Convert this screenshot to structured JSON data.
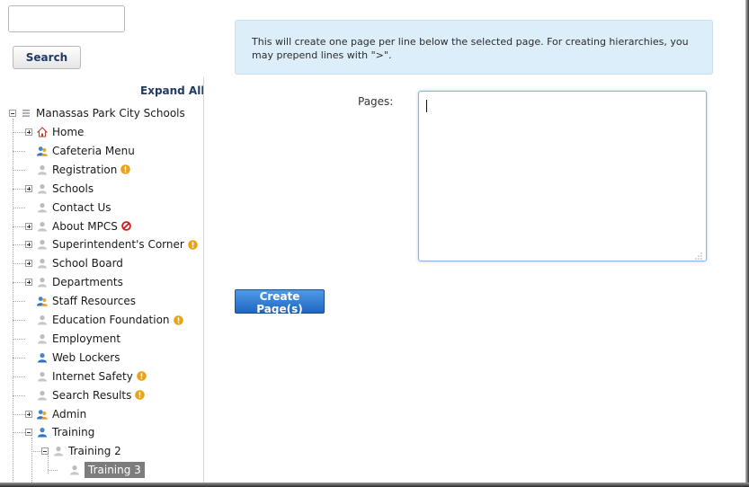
{
  "search": {
    "button_label": "Search",
    "input_value": ""
  },
  "tree": {
    "expand_all_label": "Expand All",
    "root": {
      "label": "Manassas Park City Schools"
    },
    "items": [
      {
        "label": "Home",
        "icon": "home-icon",
        "status": null,
        "expander": "plus"
      },
      {
        "label": "Cafeteria Menu",
        "icon": "user-group-icon",
        "status": null,
        "expander": null
      },
      {
        "label": "Registration",
        "icon": "user-gray-icon",
        "status": "warning",
        "expander": null
      },
      {
        "label": "Schools",
        "icon": "user-gray-icon",
        "status": null,
        "expander": "plus"
      },
      {
        "label": "Contact Us",
        "icon": "user-gray-icon",
        "status": null,
        "expander": null
      },
      {
        "label": "About MPCS",
        "icon": "user-gray-icon",
        "status": "blocked",
        "expander": "plus"
      },
      {
        "label": "Superintendent's Corner",
        "icon": "user-gray-icon",
        "status": "warning",
        "expander": "plus"
      },
      {
        "label": "School Board",
        "icon": "user-gray-icon",
        "status": null,
        "expander": "plus"
      },
      {
        "label": "Departments",
        "icon": "user-gray-icon",
        "status": null,
        "expander": "plus"
      },
      {
        "label": "Staff Resources",
        "icon": "user-group-icon",
        "status": null,
        "expander": null
      },
      {
        "label": "Education Foundation",
        "icon": "user-gray-icon",
        "status": "warning",
        "expander": null
      },
      {
        "label": "Employment",
        "icon": "user-gray-icon",
        "status": null,
        "expander": null
      },
      {
        "label": "Web Lockers",
        "icon": "user-blue-icon",
        "status": null,
        "expander": null
      },
      {
        "label": "Internet Safety",
        "icon": "user-gray-icon",
        "status": "warning",
        "expander": null
      },
      {
        "label": "Search Results",
        "icon": "user-gray-icon",
        "status": "warning",
        "expander": null
      },
      {
        "label": "Admin",
        "icon": "user-group-icon",
        "status": null,
        "expander": "plus"
      },
      {
        "label": "Training",
        "icon": "user-blue-icon",
        "status": null,
        "expander": "minus"
      },
      {
        "label": "Training 2",
        "icon": "user-gray-icon",
        "status": null,
        "expander": "minus"
      },
      {
        "label": "Training 3",
        "icon": "user-gray-icon",
        "status": null,
        "expander": null,
        "selected": true
      }
    ]
  },
  "info_text": "This will create one page per line below the selected page. For creating hierarchies, you may prepend lines with \">\".",
  "form": {
    "pages_label": "Pages:",
    "pages_value": "",
    "create_button_label": "Create Page(s)"
  },
  "colors": {
    "info_bg": "#ddeefb",
    "primary_button": "#2a74cf",
    "warning": "#e8a317",
    "blocked": "#cc1e1e",
    "selected_bg": "#7c7c7c"
  }
}
